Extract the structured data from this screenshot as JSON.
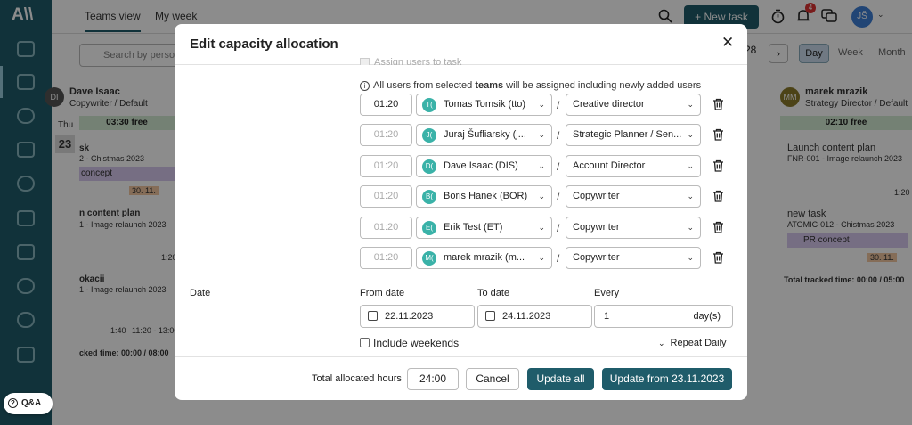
{
  "app": {
    "logo": "A\\\\"
  },
  "topbar": {
    "tabs": [
      "Teams view",
      "My week"
    ],
    "new_task": "+ New task",
    "notifications": "4",
    "user_initials": "JŠ"
  },
  "background": {
    "search_placeholder": "Search by person",
    "date_nav": "28",
    "views": [
      "Day",
      "Week",
      "Month"
    ],
    "left_person": {
      "initials": "DI",
      "name": "Dave Isaac",
      "role": "Copywriter / Default"
    },
    "right_person": {
      "initials": "MM",
      "name": "marek mrazik",
      "role": "Strategy Director / Default"
    },
    "left_day": {
      "weekday": "Thu",
      "date": "23"
    },
    "left_free": "03:30 free",
    "right_free": "02:10 free",
    "left_cards": [
      {
        "title": "sk",
        "sub": "2 - Chistmas 2023"
      },
      {
        "title": "concept"
      },
      {
        "title": "30. 11."
      },
      {
        "title": "n content plan",
        "sub": "1 - Image relaunch 2023"
      },
      {
        "title": "1:20"
      },
      {
        "title": "okacii",
        "sub": "1 - Image relaunch 2023"
      },
      {
        "title": "1:40"
      },
      {
        "title": "11:20 - 13:00"
      },
      {
        "title": "cked time: 00:00 / 08:00"
      }
    ],
    "right_cards": [
      {
        "title": "Launch content plan",
        "sub": "FNR-001 - Image relaunch 2023"
      },
      {
        "title": "1:20"
      },
      {
        "title": "new task",
        "sub": "ATOMIC-012 - Chistmas 2023"
      },
      {
        "title": "PR concept"
      },
      {
        "title": "30. 11."
      },
      {
        "title": "Total tracked time: 00:00 / 05:00"
      }
    ]
  },
  "modal": {
    "title": "Edit capacity allocation",
    "info_pre": "All users from selected ",
    "info_bold": "teams",
    "info_post": " will be assigned including newly added users",
    "hidden_row": "Assign users to task",
    "allocations": [
      {
        "hours": "01:20",
        "initials": "T(",
        "user": "Tomas Tomsik (tto)",
        "role": "Creative director"
      },
      {
        "hours": "01:20",
        "initials": "J(",
        "user": "Juraj Šufliarsky (j...",
        "role": "Strategic Planner / Sen..."
      },
      {
        "hours": "01:20",
        "initials": "D(",
        "user": "Dave Isaac (DIS)",
        "role": "Account Director"
      },
      {
        "hours": "01:20",
        "initials": "B(",
        "user": "Boris Hanek (BOR)",
        "role": "Copywriter"
      },
      {
        "hours": "01:20",
        "initials": "E(",
        "user": "Erik Test (ET)",
        "role": "Copywriter"
      },
      {
        "hours": "01:20",
        "initials": "M(",
        "user": "marek mrazik (m...",
        "role": "Copywriter"
      }
    ],
    "date_label": "Date",
    "from_label": "From date",
    "to_label": "To date",
    "every_label": "Every",
    "from_value": "22.11.2023",
    "to_value": "24.11.2023",
    "every_value": "1",
    "every_unit": "day(s)",
    "weekends_label": "Include weekends",
    "repeat_label": "Repeat Daily",
    "total_label": "Total allocated hours",
    "total_value": "24:00",
    "cancel": "Cancel",
    "update_all": "Update all",
    "update_from": "Update from 23.11.2023"
  },
  "qa": "Q&A"
}
